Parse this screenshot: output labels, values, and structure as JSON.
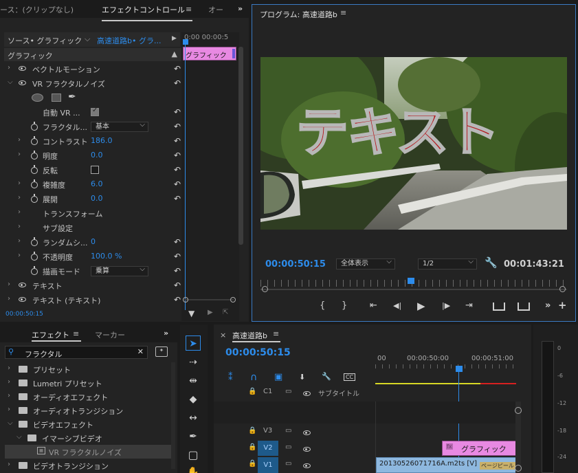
{
  "effect_controls": {
    "tabs": [
      "ース：(クリップなし)",
      "エフェクトコントロール",
      "オー"
    ],
    "menu_icon": "hamburger-icon",
    "overflow": "»",
    "source_label": "ソース• グラフィック",
    "seq_label": "高速道路b• グラ...",
    "time_ruler": "0:00 00:00:5",
    "clip_label": "グラフィック",
    "section_title": "グラフィック",
    "rows": [
      {
        "label": "ベクトルモーション",
        "value": ""
      },
      {
        "label": "VR フラクタルノイズ",
        "value": ""
      },
      {
        "label": "自動 VR ...",
        "value": ""
      },
      {
        "label": "フラクタル...",
        "value": "基本"
      },
      {
        "label": "コントラスト",
        "value": "186.0"
      },
      {
        "label": "明度",
        "value": "0.0"
      },
      {
        "label": "反転",
        "value": ""
      },
      {
        "label": "複雑度",
        "value": "6.0"
      },
      {
        "label": "展開",
        "value": "0.0"
      },
      {
        "label": "トランスフォーム",
        "value": ""
      },
      {
        "label": "サブ設定",
        "value": ""
      },
      {
        "label": "ランダムシ...",
        "value": "0"
      },
      {
        "label": "不透明度",
        "value": "100.0 %"
      },
      {
        "label": "描画モード",
        "value": "乗算"
      },
      {
        "label": "テキスト",
        "value": ""
      },
      {
        "label": "テキスト (テキスト)",
        "value": ""
      }
    ],
    "timecode": "00:00:50:15"
  },
  "program": {
    "title": "プログラム: 高速道路b",
    "overlay_text": "テキスト",
    "timecode": "00:00:50:15",
    "zoom": "全体表示",
    "resolution": "1/2",
    "duration": "00:01:43:21",
    "playhead_fraction": 0.49,
    "controls": [
      "{",
      "}",
      "⇤",
      "◀|",
      "▶",
      "|▶",
      "⇥",
      "lift",
      "extract",
      "»",
      "+"
    ]
  },
  "effects_panel": {
    "tabs": [
      "エフェクト",
      "マーカー"
    ],
    "overflow": "»",
    "search_value": "フラクタル",
    "items": [
      {
        "label": "プリセット",
        "indent": 0
      },
      {
        "label": "Lumetri プリセット",
        "indent": 0
      },
      {
        "label": "オーディオエフェクト",
        "indent": 0
      },
      {
        "label": "オーディオトランジション",
        "indent": 0
      },
      {
        "label": "ビデオエフェクト",
        "indent": 0
      },
      {
        "label": "イマーシブビデオ",
        "indent": 1
      },
      {
        "label": "VR フラクタルノイズ",
        "indent": 2
      },
      {
        "label": "ビデオトランジション",
        "indent": 0
      }
    ]
  },
  "timeline": {
    "title": "高速道路b",
    "timecode": "00:00:50:15",
    "ruler": [
      "00",
      "00:00:50:00",
      "00:00:51:00"
    ],
    "tracks": [
      {
        "name": "C1",
        "extra": "サブタイトル"
      },
      {
        "name": "V3",
        "extra": ""
      },
      {
        "name": "V2",
        "extra": ""
      },
      {
        "name": "V1",
        "extra": ""
      }
    ],
    "clip_v2": "グラフィック",
    "clip_v1": "20130526071716A.m2ts [V]",
    "clip_v1_b": "ページピール"
  },
  "meter": {
    "labels": [
      "0",
      "-6",
      "-12",
      "-18",
      "-24"
    ]
  }
}
